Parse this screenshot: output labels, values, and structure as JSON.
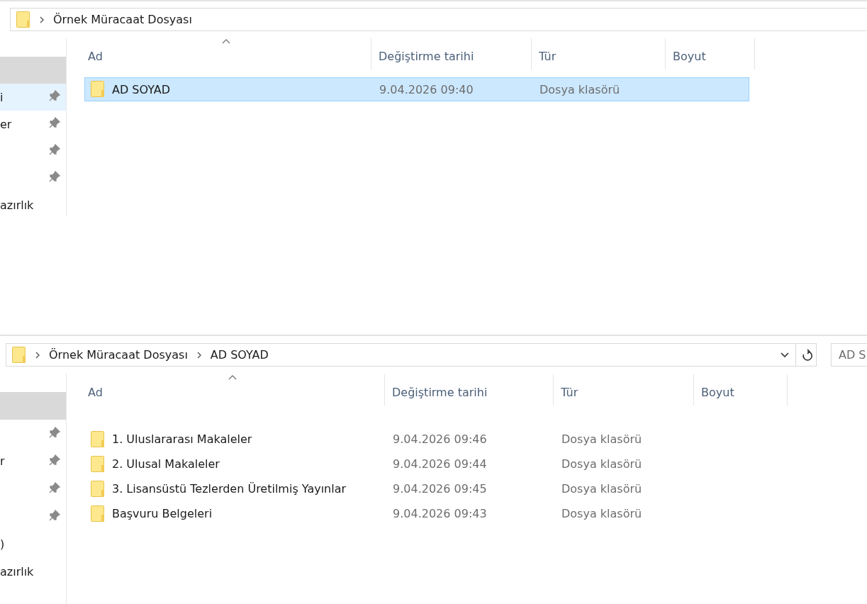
{
  "panes": [
    {
      "address_bar": {
        "crumbs": [
          "Örnek Müracaat Dosyası"
        ]
      },
      "sidebar": {
        "items": [
          {
            "pinned": false,
            "selected": false,
            "hovered": true
          },
          {
            "label": "i",
            "pinned": true,
            "selected": true,
            "hovered": false
          },
          {
            "label": "er",
            "pinned": true,
            "selected": false,
            "hovered": false
          },
          {
            "pinned": true,
            "selected": false,
            "hovered": false
          },
          {
            "pinned": true,
            "selected": false,
            "hovered": false
          },
          {
            "label": "azırlık",
            "pinned": false,
            "selected": false,
            "hovered": false
          }
        ]
      },
      "table": {
        "columns": [
          {
            "label": "Ad",
            "sorted": true
          },
          {
            "label": "Değiştirme tarihi",
            "sorted": false
          },
          {
            "label": "Tür",
            "sorted": false
          },
          {
            "label": "Boyut",
            "sorted": false
          }
        ],
        "rows": [
          {
            "name": "AD SOYAD",
            "modified": "9.04.2026 09:40",
            "type": "Dosya klasörü",
            "selected": true
          }
        ]
      }
    },
    {
      "address_bar": {
        "crumbs": [
          "Örnek Müracaat Dosyası",
          "AD SOYAD"
        ],
        "history_dropdown": true,
        "refresh": true
      },
      "search": {
        "value": "AD S"
      },
      "sidebar": {
        "items": [
          {
            "pinned": false,
            "selected": false,
            "hovered": true
          },
          {
            "pinned": true,
            "selected": false,
            "hovered": false
          },
          {
            "label": "r",
            "pinned": true,
            "selected": false,
            "hovered": false
          },
          {
            "pinned": true,
            "selected": false,
            "hovered": false
          },
          {
            "pinned": true,
            "selected": false,
            "hovered": false
          },
          {
            "label": ")",
            "pinned": false,
            "selected": false,
            "hovered": false
          },
          {
            "label": "azırlık",
            "pinned": false,
            "selected": false,
            "hovered": false
          }
        ]
      },
      "table": {
        "columns": [
          {
            "label": "Ad",
            "sorted": true
          },
          {
            "label": "Değiştirme tarihi",
            "sorted": false
          },
          {
            "label": "Tür",
            "sorted": false
          },
          {
            "label": "Boyut",
            "sorted": false
          }
        ],
        "rows": [
          {
            "name": "1. Uluslararası Makaleler",
            "modified": "9.04.2026 09:46",
            "type": "Dosya klasörü",
            "selected": false
          },
          {
            "name": "2. Ulusal Makaleler",
            "modified": "9.04.2026 09:44",
            "type": "Dosya klasörü",
            "selected": false
          },
          {
            "name": "3. Lisansüstü Tezlerden Üretilmiş Yayınlar",
            "modified": "9.04.2026 09:45",
            "type": "Dosya klasörü",
            "selected": false
          },
          {
            "name": "Başvuru Belgeleri",
            "modified": "9.04.2026 09:43",
            "type": "Dosya klasörü",
            "selected": false
          }
        ]
      }
    }
  ]
}
